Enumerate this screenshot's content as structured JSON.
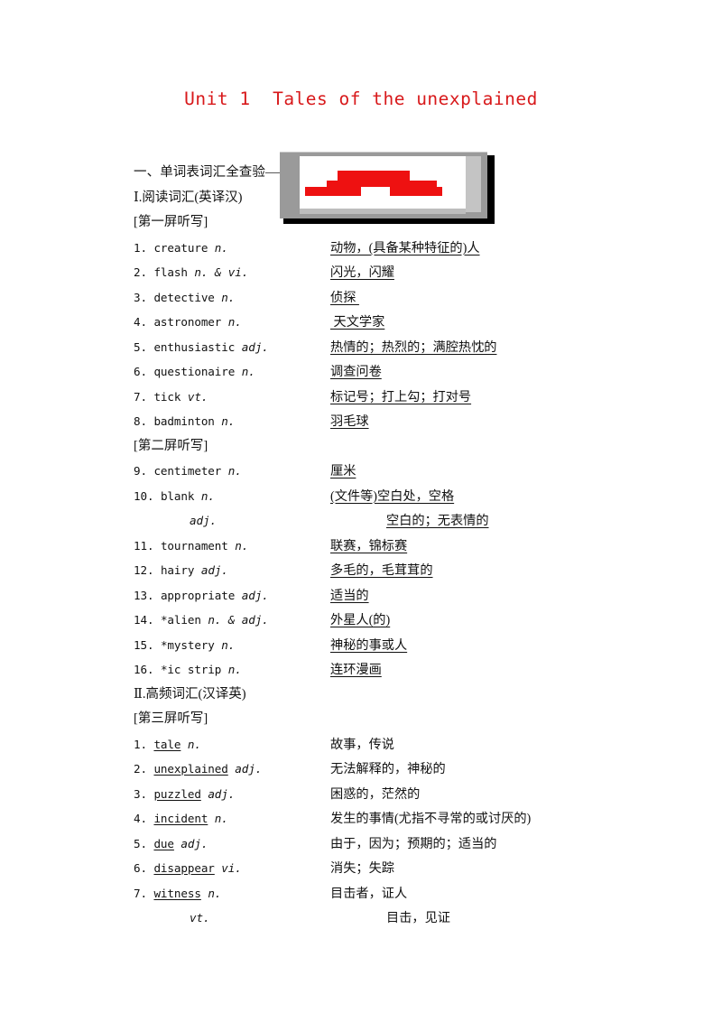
{
  "document": {
    "title": "Unit 1  Tales of the unexplained",
    "title_color": "#d8191b"
  },
  "section_one": {
    "heading": "一、单词表词汇全查验——运用多媒体，提问默写词汇",
    "subsection_1": {
      "label": "Ⅰ.阅读词汇(英译汉)",
      "screens": [
        {
          "screen_label": "[第一屏听写]",
          "entries": [
            {
              "num": "1.",
              "word": "creature",
              "pos": "n.",
              "answer": "动物，(具备某种特征的)人"
            },
            {
              "num": "2.",
              "word": "flash",
              "pos": "n. & vi.",
              "answer": "闪光，闪耀"
            },
            {
              "num": "3.",
              "word": "detective",
              "pos": "n.",
              "answer": "侦探 "
            },
            {
              "num": "4.",
              "word": "astronomer",
              "pos": "n.",
              "answer": " 天文学家"
            },
            {
              "num": "5.",
              "word": "enthusiastic",
              "pos": "adj.",
              "answer": "热情的；热烈的；满腔热忱的"
            },
            {
              "num": "6.",
              "word": "questionaire",
              "pos": "n.",
              "answer": "调查问卷"
            },
            {
              "num": "7.",
              "word": "tick",
              "pos": "vt.",
              "answer": "标记号；打上勾；打对号"
            },
            {
              "num": "8.",
              "word": "badminton",
              "pos": "n.",
              "answer": "羽毛球"
            }
          ]
        },
        {
          "screen_label": "[第二屏听写]",
          "entries": [
            {
              "num": "9.",
              "word": "centimeter",
              "pos": "n.",
              "answer": "厘米"
            },
            {
              "num": "10.",
              "word": "blank",
              "pos": "n.",
              "answer": "(文件等)空白处，空格"
            },
            {
              "num": "",
              "word": "",
              "pos": "adj.",
              "answer": "空白的；无表情的",
              "sub": true
            },
            {
              "num": "11.",
              "word": "tournament",
              "pos": "n.",
              "answer": "联赛，锦标赛"
            },
            {
              "num": "12.",
              "word": "hairy",
              "pos": "adj.",
              "answer": "多毛的，毛茸茸的"
            },
            {
              "num": "13.",
              "word": "appropriate",
              "pos": "adj.",
              "answer": "适当的"
            },
            {
              "num": "14.",
              "word": "*alien",
              "pos": "n. & adj.",
              "answer": "外星人(的)"
            },
            {
              "num": "15.",
              "word": "*mystery",
              "pos": "n.",
              "answer": "神秘的事或人"
            },
            {
              "num": "16.",
              "word": "*ic strip",
              "pos": "n.",
              "answer": "连环漫画"
            }
          ]
        }
      ]
    },
    "subsection_2": {
      "label": "Ⅱ.高频词汇(汉译英)",
      "screens": [
        {
          "screen_label": "[第三屏听写]",
          "entries": [
            {
              "num": "1.",
              "word": "tale",
              "pos": "n.",
              "answer": "故事，传说"
            },
            {
              "num": "2.",
              "word": "unexplained",
              "pos": "adj.",
              "answer": "无法解释的，神秘的"
            },
            {
              "num": "3.",
              "word": "puzzled",
              "pos": "adj.",
              "answer": "困惑的，茫然的"
            },
            {
              "num": "4.",
              "word": "incident",
              "pos": "n.",
              "answer": "发生的事情(尤指不寻常的或讨厌的)"
            },
            {
              "num": "5.",
              "word": "due",
              "pos": "adj.",
              "answer": "由于，因为；预期的；适当的"
            },
            {
              "num": "6.",
              "word": "disappear",
              "pos": "vi.",
              "answer": "消失；失踪"
            },
            {
              "num": "7.",
              "word": "witness",
              "pos": "n.",
              "answer": "目击者，证人"
            },
            {
              "num": "",
              "word": "",
              "pos": "vt.",
              "answer": "目击，见证",
              "sub": true
            }
          ]
        }
      ]
    }
  },
  "media_figure": {
    "name": "multimedia-illustration",
    "frame_color": "#9a9a9a",
    "accent_color": "#ee1111"
  }
}
